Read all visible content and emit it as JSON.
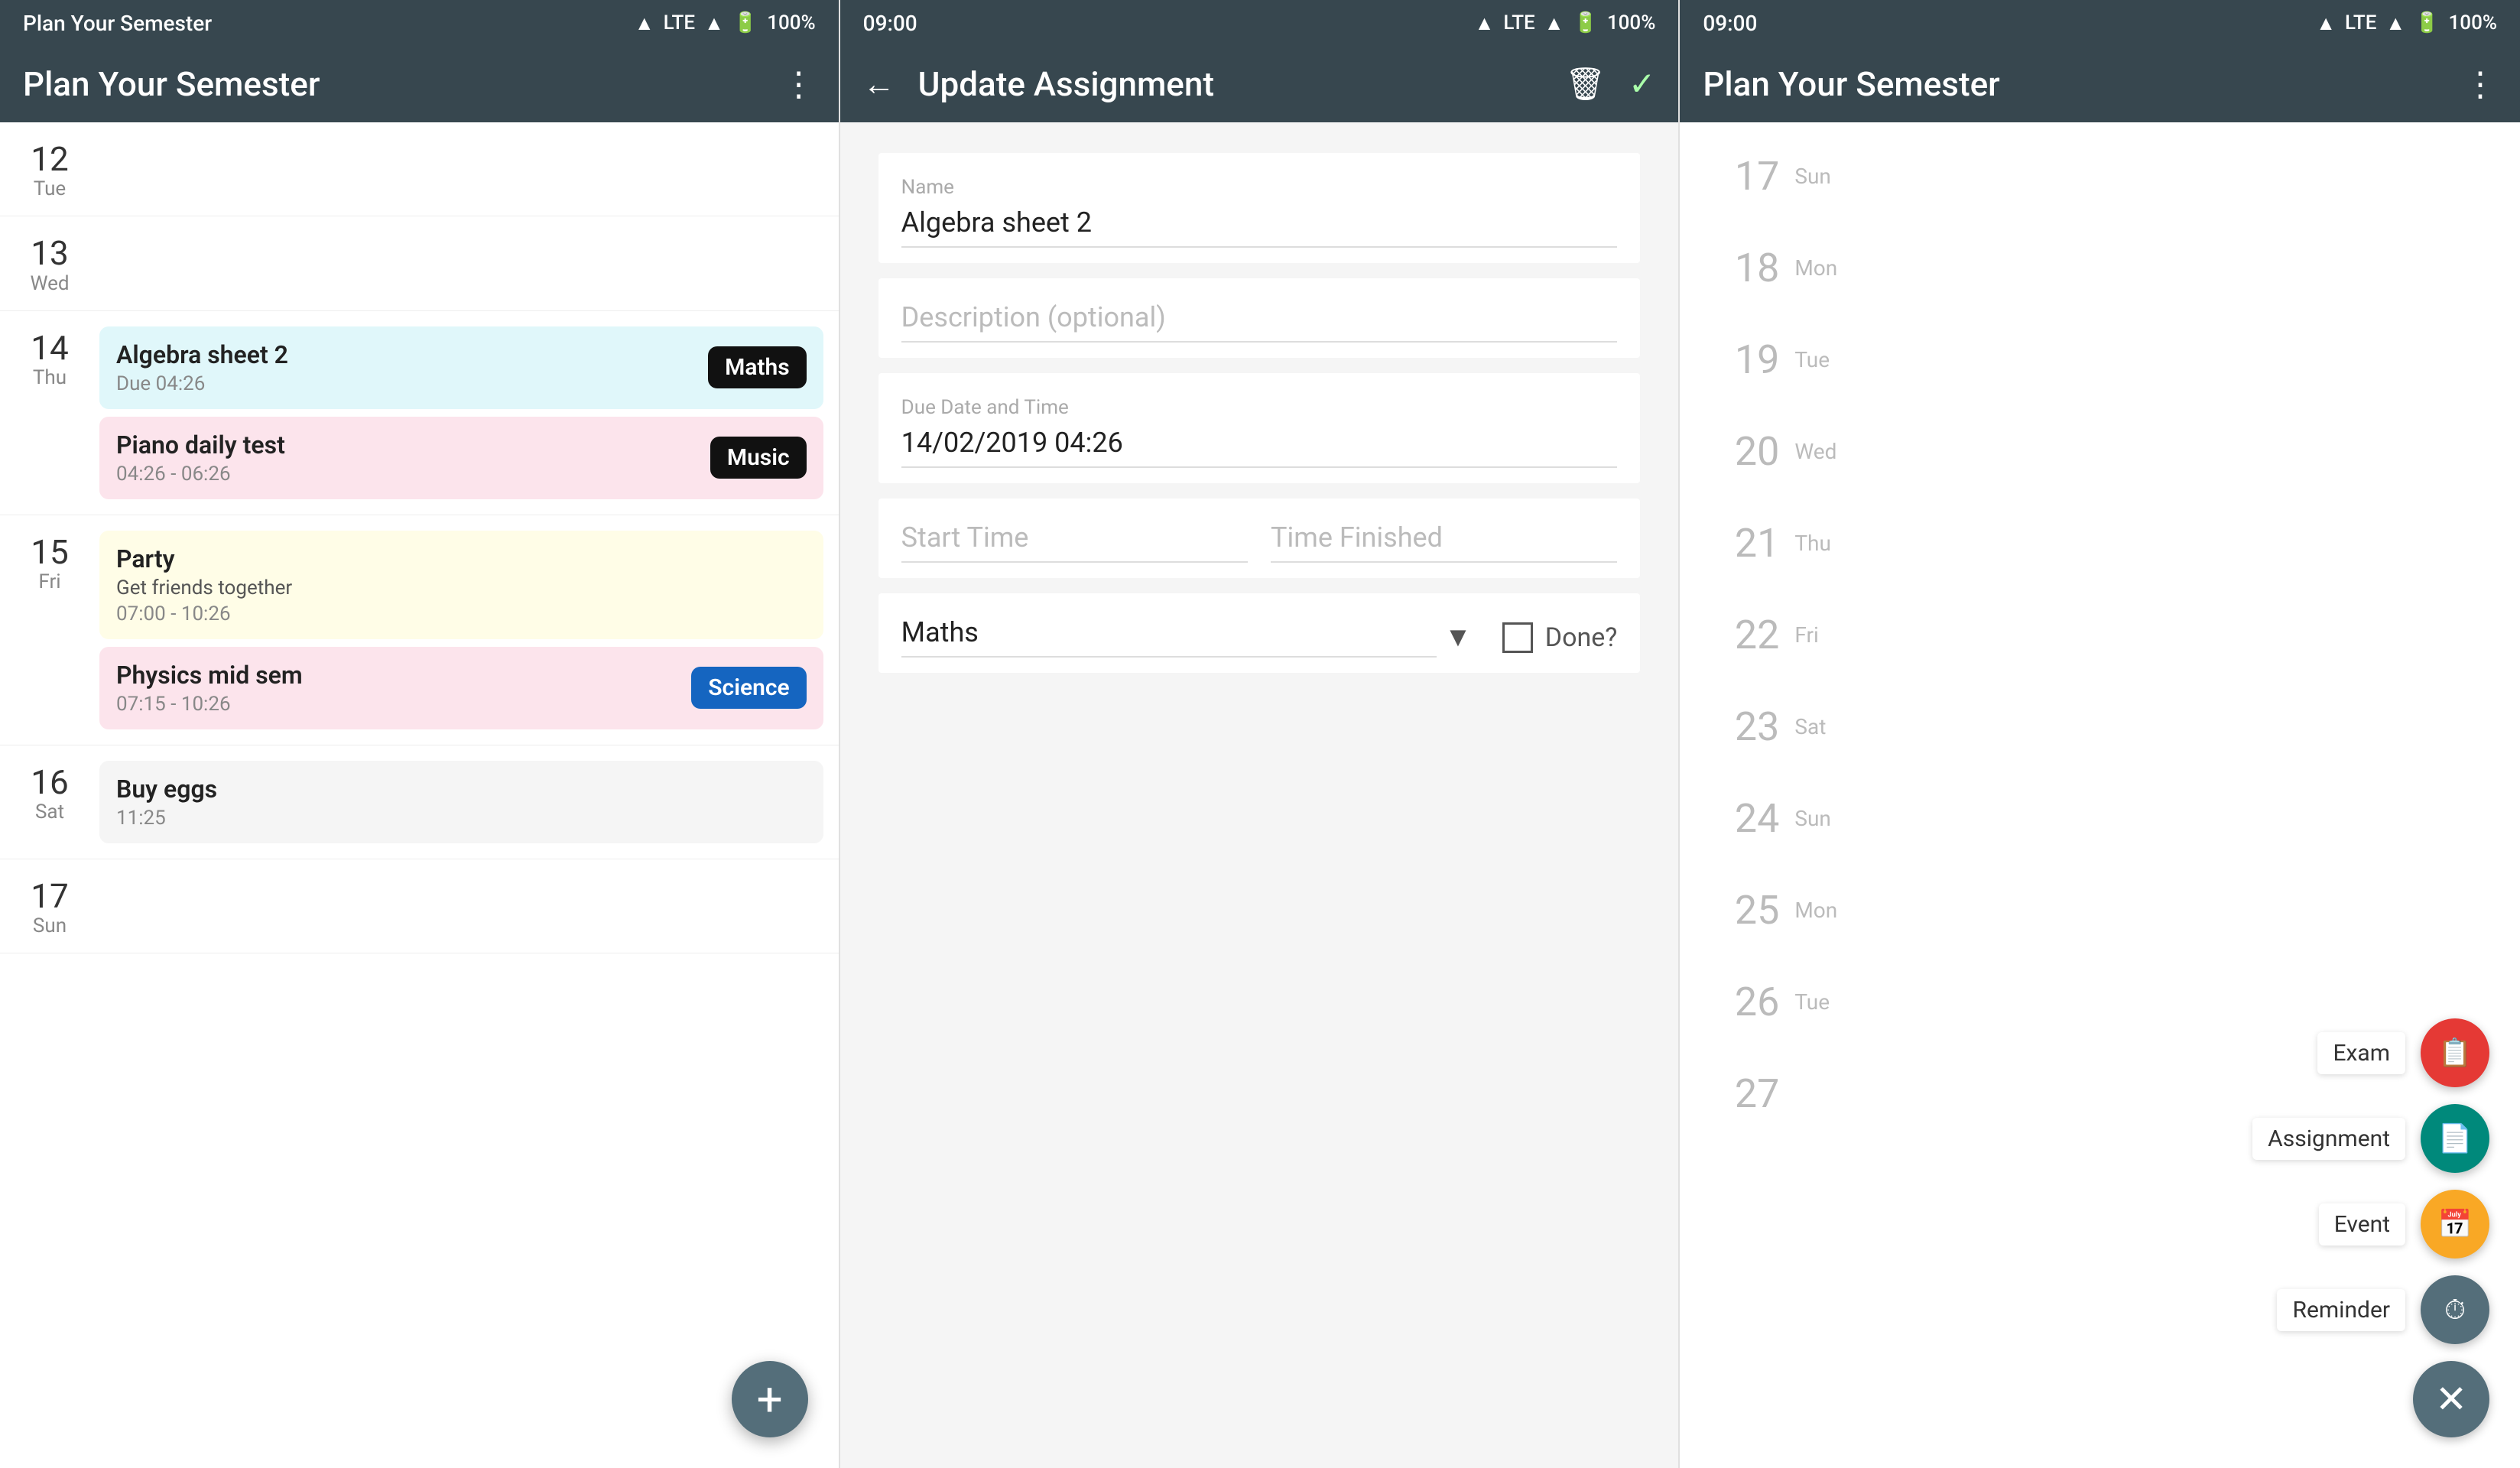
{
  "app": {
    "title": "Plan Your Semester",
    "status_time": "09:00",
    "status_icons": "▲ LTE ▲ 🔋 100%"
  },
  "screen1": {
    "header": {
      "title": "Plan Your Semester",
      "more_icon": "⋮"
    },
    "days": [
      {
        "number": "12",
        "name": "Tue",
        "events": []
      },
      {
        "number": "13",
        "name": "Wed",
        "events": []
      },
      {
        "number": "14",
        "name": "Thu",
        "events": [
          {
            "id": "algebra",
            "title": "Algebra sheet 2",
            "subtitle": "Due 04:26",
            "badge": "Maths",
            "badge_color": "black",
            "card_color": "blue"
          },
          {
            "id": "piano",
            "title": "Piano daily test",
            "subtitle": "04:26 - 06:26",
            "badge": "Music",
            "badge_color": "black",
            "card_color": "pink"
          }
        ]
      },
      {
        "number": "15",
        "name": "Fri",
        "events": [
          {
            "id": "party",
            "title": "Party",
            "desc": "Get friends together",
            "subtitle": "07:00 - 10:26",
            "badge": "",
            "card_color": "yellow"
          },
          {
            "id": "physics",
            "title": "Physics mid sem",
            "subtitle": "07:15 - 10:26",
            "badge": "Science",
            "badge_color": "blue",
            "card_color": "pink"
          }
        ]
      },
      {
        "number": "16",
        "name": "Sat",
        "events": [
          {
            "id": "eggs",
            "title": "Buy eggs",
            "subtitle": "11:25",
            "badge": "",
            "card_color": "gray"
          }
        ]
      },
      {
        "number": "17",
        "name": "Sun",
        "events": []
      }
    ],
    "fab_icon": "+"
  },
  "screen2": {
    "header": {
      "back_icon": "←",
      "title": "Update Assignment",
      "delete_icon": "🗑",
      "check_icon": "✓"
    },
    "form": {
      "name_label": "Name",
      "name_value": "Algebra sheet 2",
      "description_placeholder": "Description (optional)",
      "due_label": "Due Date and Time",
      "due_value": "14/02/2019 04:26",
      "start_time_placeholder": "Start Time",
      "time_finished_placeholder": "Time Finished",
      "subject_value": "Maths",
      "done_label": "Done?"
    }
  },
  "screen3": {
    "header": {
      "title": "Plan Your Semester",
      "more_icon": "⋮"
    },
    "days": [
      {
        "number": "17",
        "name": "Sun"
      },
      {
        "number": "18",
        "name": "Mon"
      },
      {
        "number": "19",
        "name": "Tue"
      },
      {
        "number": "20",
        "name": "Wed"
      },
      {
        "number": "21",
        "name": "Thu"
      },
      {
        "number": "22",
        "name": "Fri"
      },
      {
        "number": "23",
        "name": "Sat"
      },
      {
        "number": "24",
        "name": "Sun"
      },
      {
        "number": "25",
        "name": "Mon"
      },
      {
        "number": "26",
        "name": "Tue"
      },
      {
        "number": "27",
        "name": "..."
      }
    ],
    "fab_menu": {
      "exam_label": "Exam",
      "assignment_label": "Assignment",
      "event_label": "Event",
      "reminder_label": "Reminder",
      "close_icon": "✕"
    }
  }
}
